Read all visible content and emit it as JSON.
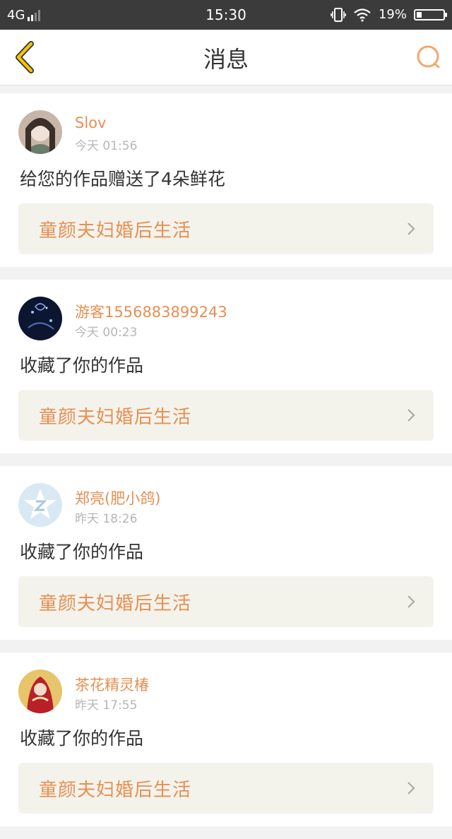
{
  "status_bar": {
    "network": "4G",
    "time": "15:30",
    "battery_text": "19%",
    "battery_level": 0.19
  },
  "header": {
    "title": "消息",
    "back_icon": "chevron-left-icon",
    "search_icon": "search-icon",
    "accent_color": "#f0c000",
    "search_color": "#f3a86a"
  },
  "notifications": [
    {
      "user": "Slov",
      "time": "今天 01:56",
      "action": "给您的作品赠送了4朵鲜花",
      "work": "童颜夫妇婚后生活"
    },
    {
      "user": "游客1556883899243",
      "time": "今天 00:23",
      "action": "收藏了你的作品",
      "work": "童颜夫妇婚后生活"
    },
    {
      "user": "郑亮(肥小鸽)",
      "time": "昨天 18:26",
      "action": "收藏了你的作品",
      "work": "童颜夫妇婚后生活"
    },
    {
      "user": "茶花精灵椿",
      "time": "昨天 17:55",
      "action": "收藏了你的作品",
      "work": "童颜夫妇婚后生活"
    }
  ],
  "colors": {
    "username": "#e78f52",
    "work_bg": "#f3f3ec",
    "time": "#b6b6b6"
  }
}
